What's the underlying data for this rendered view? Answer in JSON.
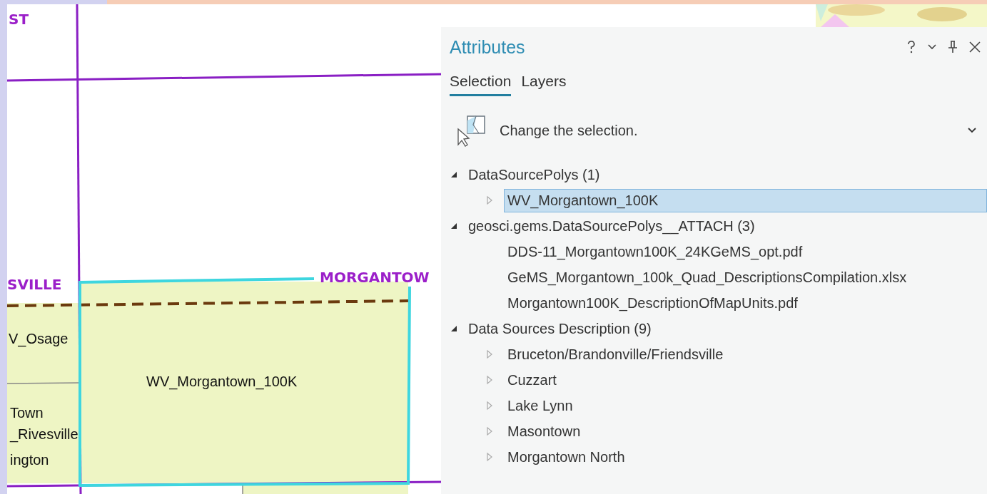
{
  "map": {
    "labels": [
      {
        "text": "ST",
        "kind": "boundary"
      },
      {
        "text": "SVILLE",
        "kind": "boundary"
      },
      {
        "text": "MORGANTOW",
        "kind": "boundary"
      },
      {
        "text": "V_Osage",
        "kind": "polygon"
      },
      {
        "text": "WV_Morgantown_100K",
        "kind": "polygon"
      },
      {
        "text": "Town",
        "kind": "polygon"
      },
      {
        "text": "_Rivesville",
        "kind": "polygon"
      },
      {
        "text": "ington",
        "kind": "polygon"
      }
    ]
  },
  "panel": {
    "title": "Attributes",
    "tabs": [
      {
        "label": "Selection",
        "selected": true
      },
      {
        "label": "Layers",
        "selected": false
      }
    ],
    "tool": {
      "label": "Change the selection."
    },
    "tree": [
      {
        "label": "DataSourcePolys (1)",
        "expanded": true,
        "children": [
          {
            "label": "WV_Morgantown_100K",
            "kind": "record",
            "selected": true
          }
        ]
      },
      {
        "label": "geosci.gems.DataSourcePolys__ATTACH (3)",
        "expanded": true,
        "children": [
          {
            "label": "DDS-11_Morgantown100K_24KGeMS_opt.pdf",
            "kind": "attachment",
            "selected": false
          },
          {
            "label": "GeMS_Morgantown_100k_Quad_DescriptionsCompilation.xlsx",
            "kind": "attachment",
            "selected": false
          },
          {
            "label": "Morgantown100K_DescriptionOfMapUnits.pdf",
            "kind": "attachment",
            "selected": false
          }
        ]
      },
      {
        "label": "Data Sources Description (9)",
        "expanded": true,
        "children": [
          {
            "label": "Bruceton/Brandonville/Friendsville",
            "kind": "record",
            "selected": false
          },
          {
            "label": "Cuzzart",
            "kind": "record",
            "selected": false
          },
          {
            "label": "Lake Lynn",
            "kind": "record",
            "selected": false
          },
          {
            "label": "Masontown",
            "kind": "record",
            "selected": false
          },
          {
            "label": "Morgantown North",
            "kind": "record",
            "selected": false
          }
        ]
      }
    ]
  }
}
